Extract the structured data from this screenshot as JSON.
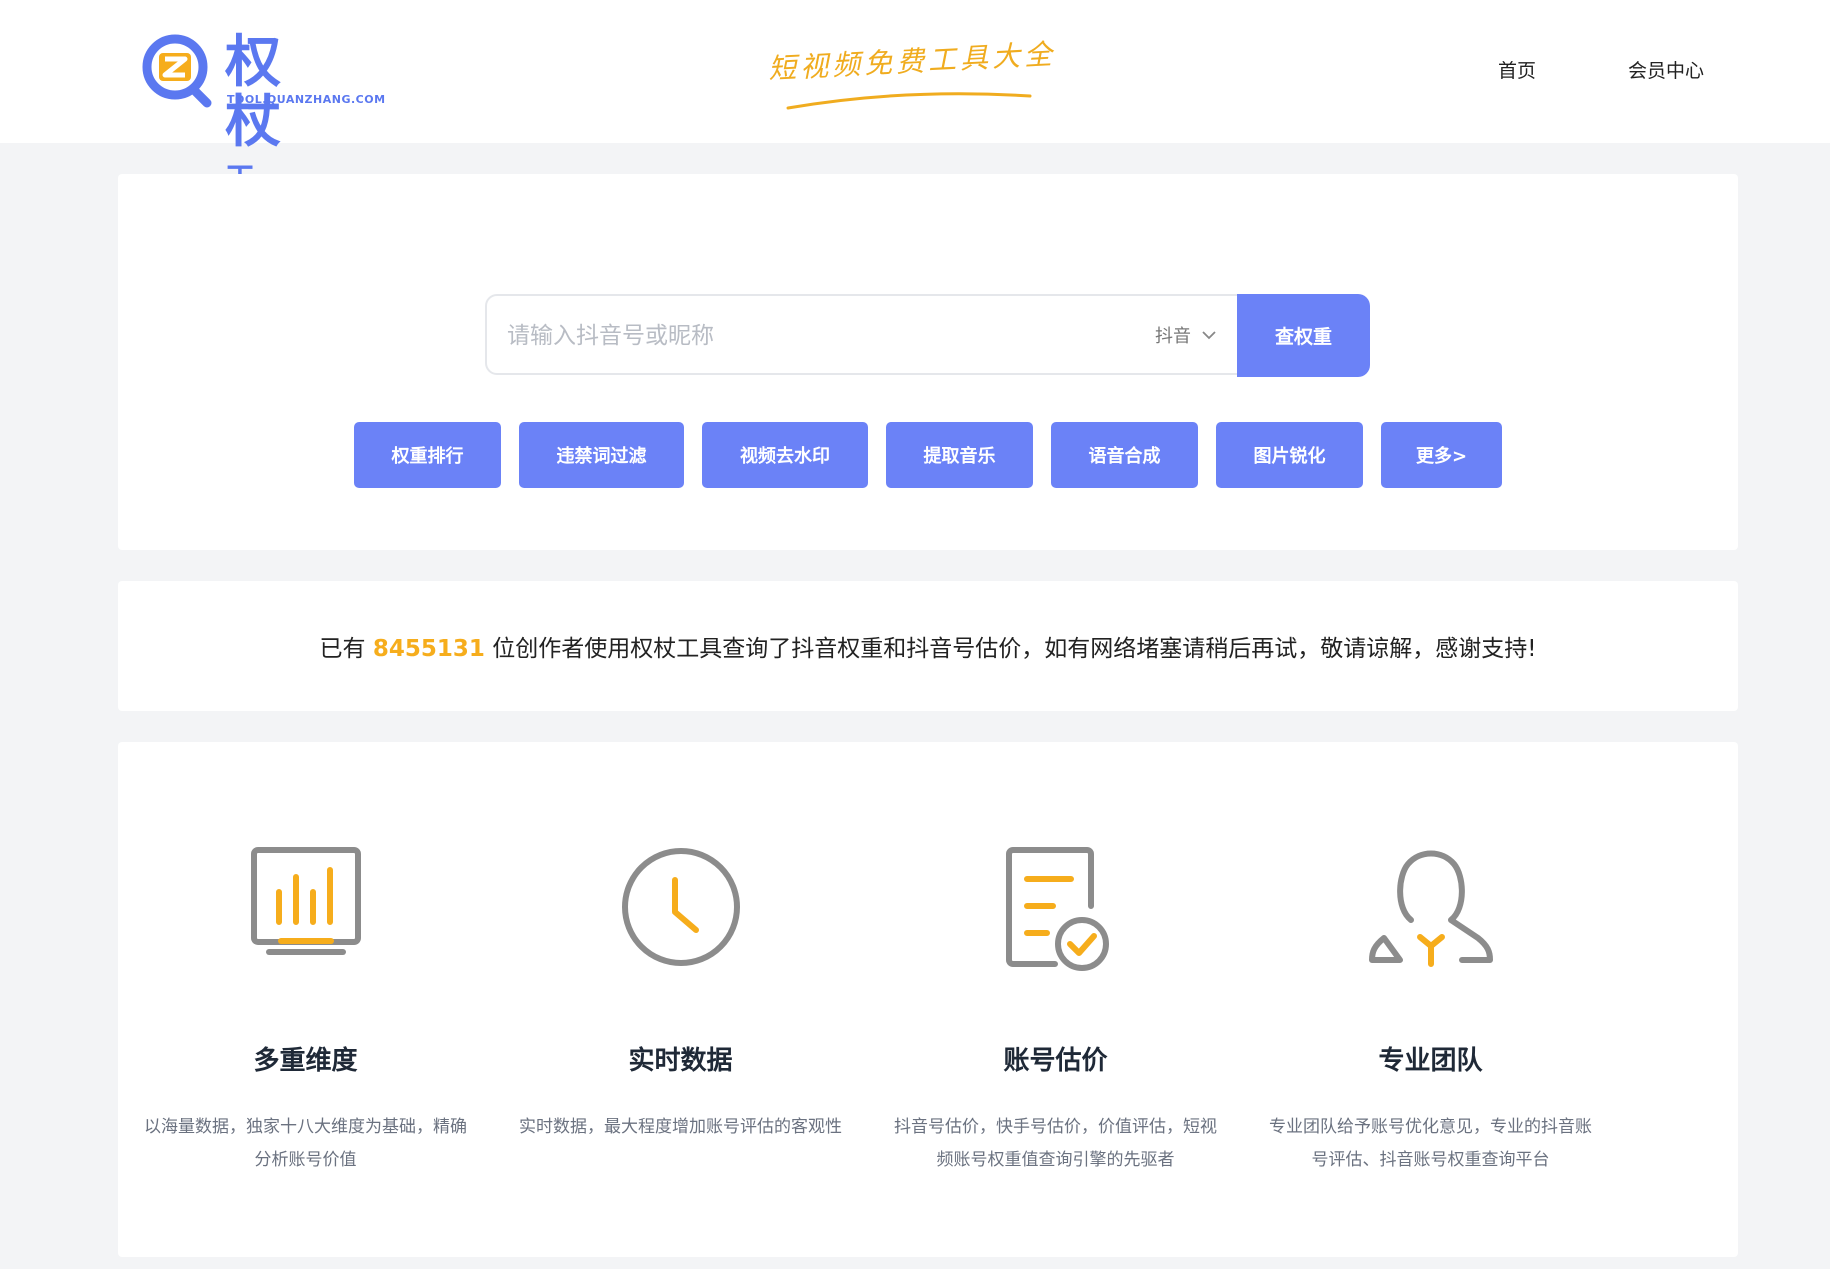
{
  "header": {
    "logo_main": "权杖",
    "logo_tag": "工具",
    "logo_sub": "TOOL.QUANZHANG.COM",
    "slogan": "短视频免费工具大全",
    "nav": [
      "首页",
      "会员中心"
    ]
  },
  "search": {
    "placeholder": "请输入抖音号或昵称",
    "platform": "抖音",
    "button": "查权重"
  },
  "tools": [
    "权重排行",
    "违禁词过滤",
    "视频去水印",
    "提取音乐",
    "语音合成",
    "图片锐化",
    "更多>"
  ],
  "notice": {
    "prefix": "已有",
    "count": "8455131",
    "suffix": "位创作者使用权杖工具查询了抖音权重和抖音号估价，如有网络堵塞请稍后再试，敬请谅解，感谢支持!"
  },
  "features": [
    {
      "icon": "bar-chart-monitor-icon",
      "title": "多重维度",
      "desc": "以海量数据，独家十八大维度为基础，精确分析账号价值"
    },
    {
      "icon": "clock-icon",
      "title": "实时数据",
      "desc": "实时数据，最大程度增加账号评估的客观性"
    },
    {
      "icon": "document-check-icon",
      "title": "账号估价",
      "desc": "抖音号估价，快手号估价，价值评估，短视频账号权重值查询引擎的先驱者"
    },
    {
      "icon": "user-icon",
      "title": "专业团队",
      "desc": "专业团队给予账号优化意见，专业的抖音账号评估、抖音账号权重查询平台"
    }
  ],
  "colors": {
    "accent": "#6b82f7",
    "highlight": "#f6ad1c",
    "icon_gray": "#8c8c8c"
  }
}
